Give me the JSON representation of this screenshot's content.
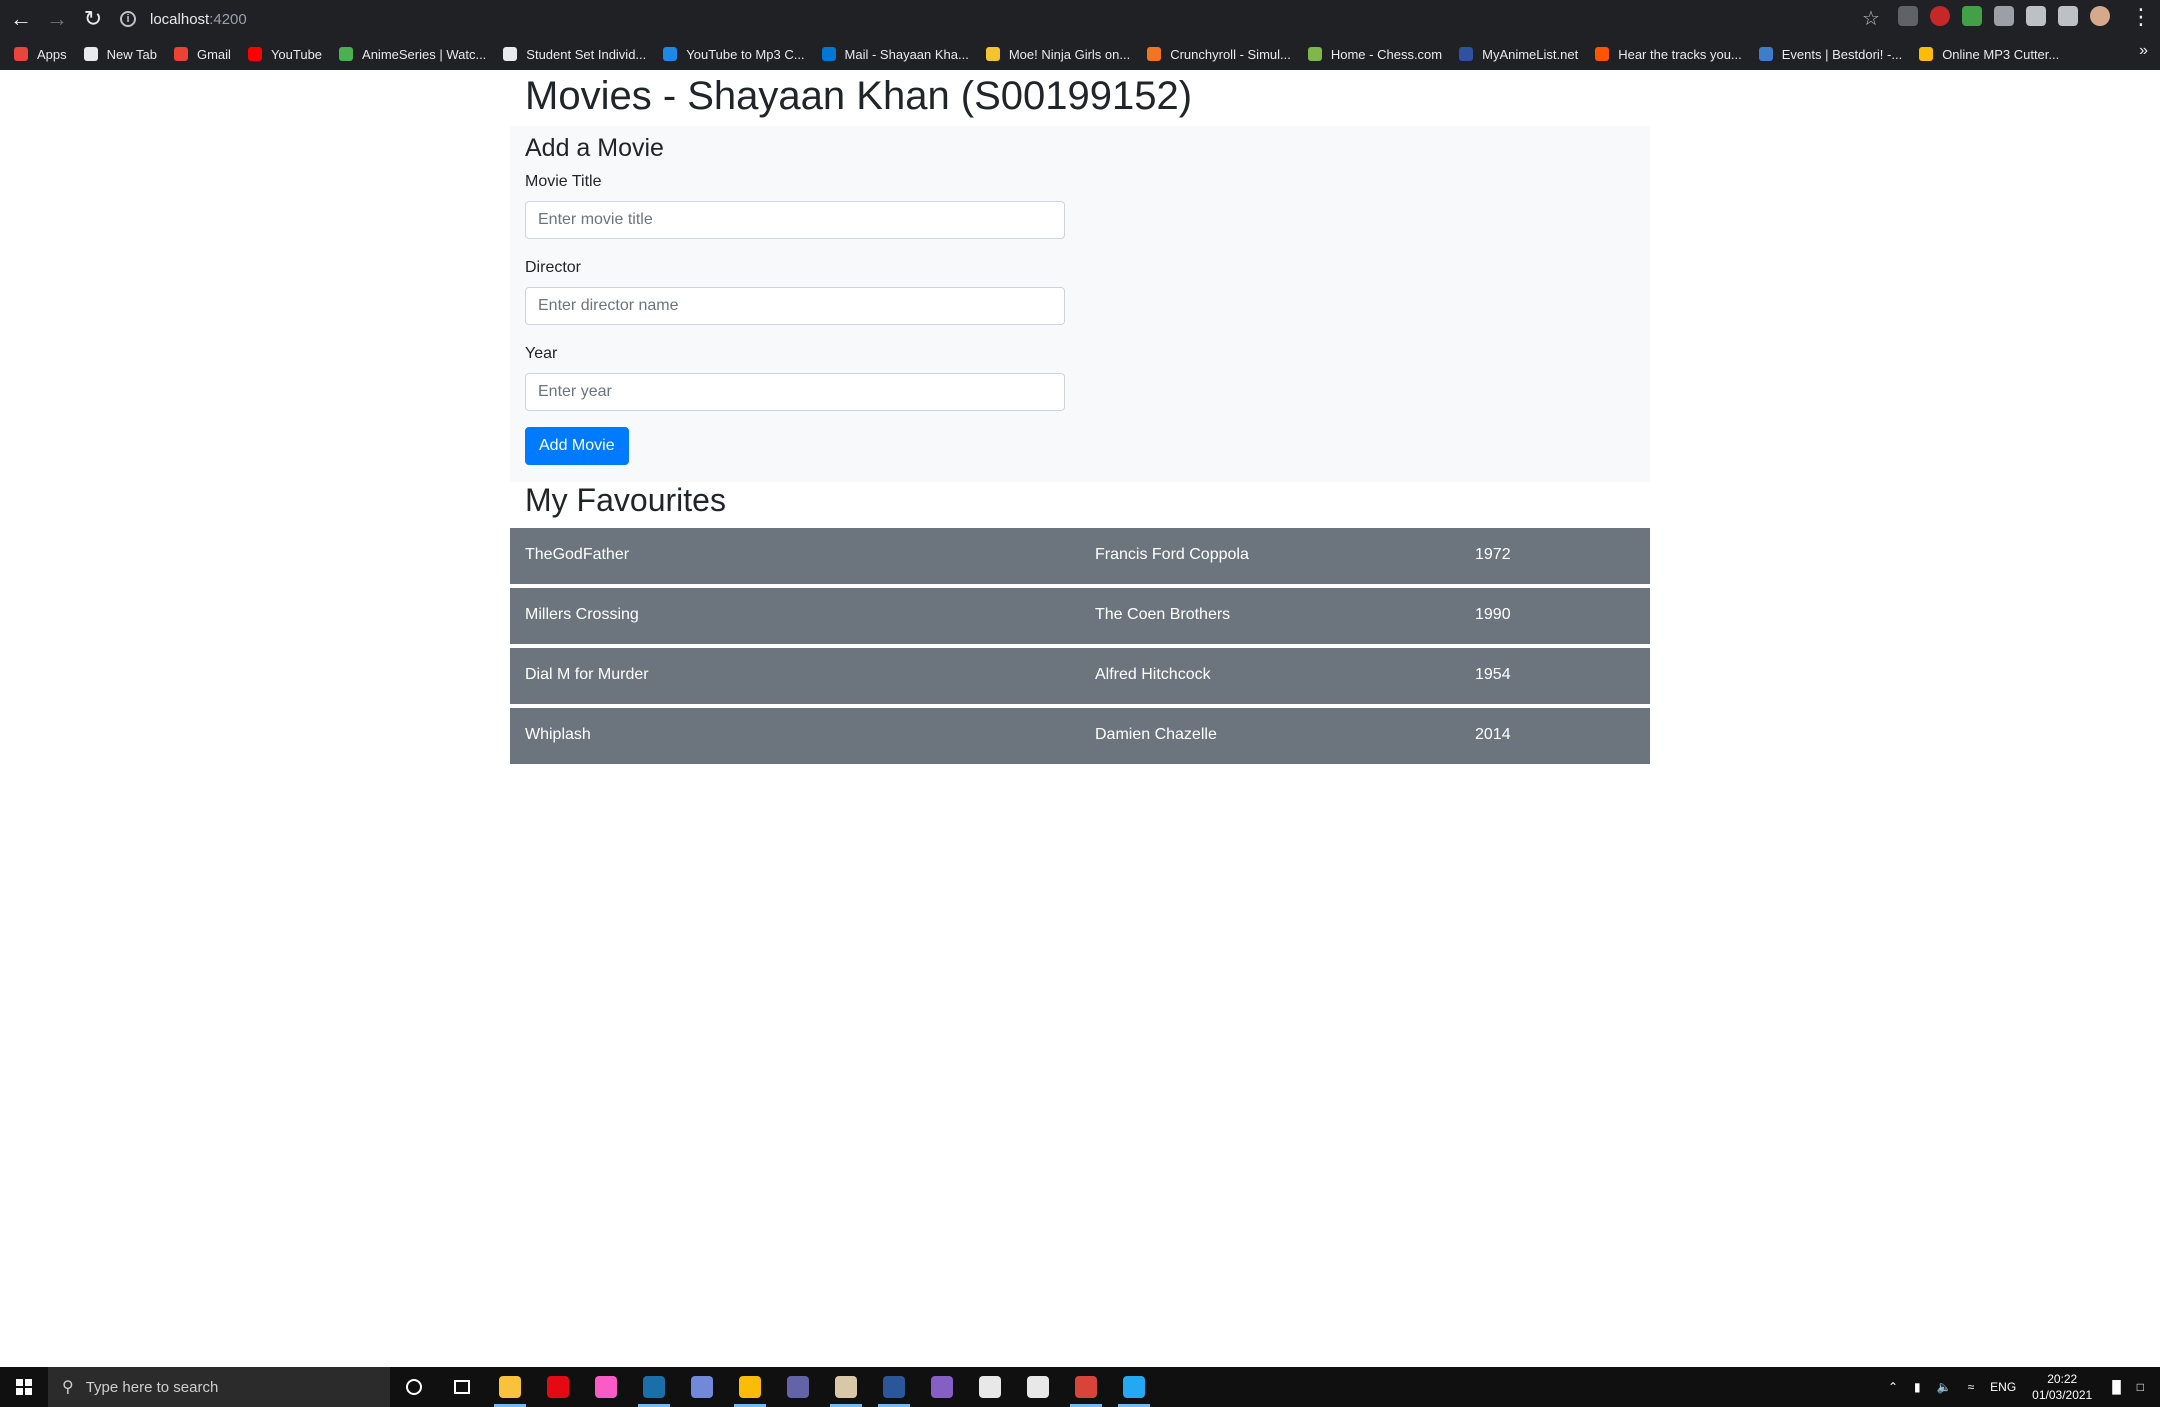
{
  "browser": {
    "url_host": "localhost",
    "url_port": ":4200",
    "bookmarks": [
      {
        "label": "Apps",
        "color": "#e8453c"
      },
      {
        "label": "New Tab",
        "color": "#e8eaed"
      },
      {
        "label": "Gmail",
        "color": "#ea4335"
      },
      {
        "label": "YouTube",
        "color": "#ff0000"
      },
      {
        "label": "AnimeSeries | Watc...",
        "color": "#4caf50"
      },
      {
        "label": "Student Set Individ...",
        "color": "#e8eaed"
      },
      {
        "label": "YouTube to Mp3 C...",
        "color": "#1e88e5"
      },
      {
        "label": "Mail - Shayaan Kha...",
        "color": "#0078d4"
      },
      {
        "label": "Moe! Ninja Girls on...",
        "color": "#f4c430"
      },
      {
        "label": "Crunchyroll - Simul...",
        "color": "#f47521"
      },
      {
        "label": "Home - Chess.com",
        "color": "#81b64c"
      },
      {
        "label": "MyAnimeList.net",
        "color": "#2e51a2"
      },
      {
        "label": "Hear the tracks you...",
        "color": "#ff5500"
      },
      {
        "label": "Events | Bestdori! -...",
        "color": "#3d7dca"
      },
      {
        "label": "Online MP3 Cutter...",
        "color": "#fbbc05"
      }
    ]
  },
  "page": {
    "title": "Movies - Shayaan Khan (S00199152)",
    "form": {
      "heading": "Add a Movie",
      "title_label": "Movie Title",
      "title_placeholder": "Enter movie title",
      "director_label": "Director",
      "director_placeholder": "Enter director name",
      "year_label": "Year",
      "year_placeholder": "Enter year",
      "submit_label": "Add Movie"
    },
    "favourites_heading": "My Favourites",
    "favourites": [
      {
        "title": "TheGodFather",
        "director": "Francis Ford Coppola",
        "year": "1972"
      },
      {
        "title": "Millers Crossing",
        "director": "The Coen Brothers",
        "year": "1990"
      },
      {
        "title": "Dial M for Murder",
        "director": "Alfred Hitchcock",
        "year": "1954"
      },
      {
        "title": "Whiplash",
        "director": "Damien Chazelle",
        "year": "2014"
      }
    ]
  },
  "taskbar": {
    "search_placeholder": "Type here to search",
    "apps": [
      {
        "name": "file-explorer-icon",
        "color": "#f8c33a",
        "active": true
      },
      {
        "name": "netflix-icon",
        "color": "#e50914",
        "active": false
      },
      {
        "name": "itunes-icon",
        "color": "#fb5bc5",
        "active": false
      },
      {
        "name": "steam-icon",
        "color": "#1b6fa8",
        "active": true
      },
      {
        "name": "discord-icon",
        "color": "#7289da",
        "active": false
      },
      {
        "name": "chrome-icon",
        "color": "#fbbc05",
        "active": true
      },
      {
        "name": "teams-icon",
        "color": "#6264a7",
        "active": false
      },
      {
        "name": "game-launcher-icon",
        "color": "#d9c8a8",
        "active": true
      },
      {
        "name": "word-icon",
        "color": "#2b579a",
        "active": true
      },
      {
        "name": "visual-studio-icon",
        "color": "#865fc5",
        "active": false
      },
      {
        "name": "settings-icon",
        "color": "#e8e8e8",
        "active": false
      },
      {
        "name": "onedrive-icon",
        "color": "#e8e8e8",
        "active": false
      },
      {
        "name": "app-red-icon",
        "color": "#d9443a",
        "active": true
      },
      {
        "name": "vscode-icon",
        "color": "#23a9f2",
        "active": true
      }
    ],
    "tray_lang": "ENG",
    "time": "20:22",
    "date": "01/03/2021"
  }
}
